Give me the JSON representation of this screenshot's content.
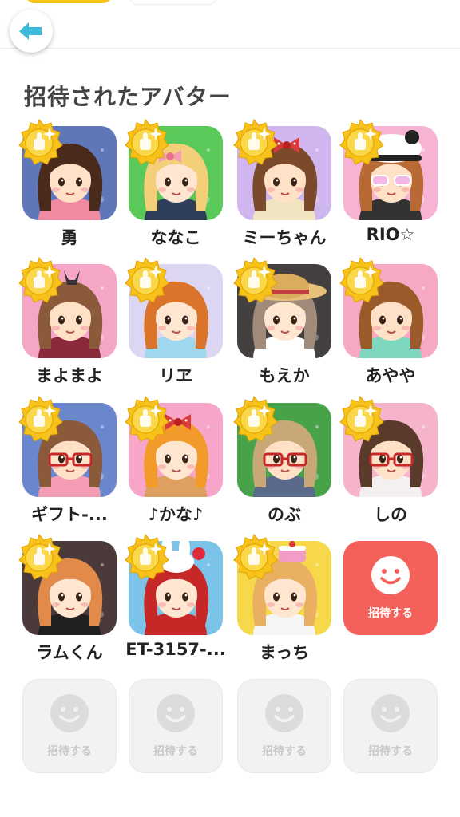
{
  "header": {
    "back_icon": "back-arrow-icon"
  },
  "section_title": "招待されたアバター",
  "avatars": [
    {
      "name": "勇",
      "bg": "#5f77b8",
      "hair": "#4a2a1a",
      "skin": "#ffe1c8",
      "top": "#f08aa0",
      "acc": "none"
    },
    {
      "name": "ななこ",
      "bg": "#5ac95a",
      "hair": "#f3cf7a",
      "skin": "#ffe6d0",
      "top": "#2f3e5a",
      "acc": "bow"
    },
    {
      "name": "ミーちゃん",
      "bg": "#cfb6ee",
      "hair": "#7a4a2a",
      "skin": "#ffe1c8",
      "top": "#f0e4c0",
      "acc": "redbow"
    },
    {
      "name": "RIO☆",
      "bg": "#f6b3d4",
      "hair": "#b86a34",
      "skin": "#ffe1c8",
      "top": "#333333",
      "acc": "panda"
    },
    {
      "name": "まよまよ",
      "bg": "#f5a6c6",
      "hair": "#8a5a3a",
      "skin": "#ffe1c8",
      "top": "#8a2a3a",
      "acc": "cat"
    },
    {
      "name": "リヱ",
      "bg": "#ddd6f2",
      "hair": "#d9742a",
      "skin": "#ffe6d0",
      "top": "#9ed7ee",
      "acc": "none"
    },
    {
      "name": "もえか",
      "bg": "#444040",
      "hair": "#a08a7a",
      "skin": "#ffe6d0",
      "top": "#ffffff",
      "acc": "hat"
    },
    {
      "name": "あやや",
      "bg": "#f7a8c2",
      "hair": "#9a5a2a",
      "skin": "#ffe1c8",
      "top": "#7ed8c0",
      "acc": "none"
    },
    {
      "name": "ギフト-...",
      "bg": "#6a86cc",
      "hair": "#8a5a3a",
      "skin": "#ffe1c8",
      "top": "#f39cb4",
      "acc": "glasses"
    },
    {
      "name": "♪かな♪",
      "bg": "#f7a5c8",
      "hair": "#f29a2a",
      "skin": "#ffe6d0",
      "top": "#e0a060",
      "acc": "redbow"
    },
    {
      "name": "のぶ",
      "bg": "#47a24a",
      "hair": "#c9a878",
      "skin": "#ffe1c8",
      "top": "#5a6a8a",
      "acc": "glasses"
    },
    {
      "name": "しの",
      "bg": "#f5b4cc",
      "hair": "#5a3a2a",
      "skin": "#ffe1c8",
      "top": "#f5f0f0",
      "acc": "glasses"
    },
    {
      "name": "ラムくん",
      "bg": "#4a3a3a",
      "hair": "#e28a4a",
      "skin": "#ffe6d0",
      "top": "#202020",
      "acc": "none"
    },
    {
      "name": "ET-3157-...",
      "bg": "#7cc3ea",
      "hair": "#c62828",
      "skin": "#ffe6d0",
      "top": "#c62828",
      "acc": "bunny"
    },
    {
      "name": "まっち",
      "bg": "#f7d84a",
      "hair": "#e8b060",
      "skin": "#ffe6d0",
      "top": "#f5f5f5",
      "acc": "cake"
    }
  ],
  "invite_active": {
    "label": "招待する"
  },
  "invite_placeholders": [
    {
      "label": "招待する"
    },
    {
      "label": "招待する"
    },
    {
      "label": "招待する"
    },
    {
      "label": "招待する"
    }
  ],
  "colors": {
    "accent_red": "#f4605a",
    "medal_gold": "#f7c21b",
    "back_arrow": "#3cb8d8"
  }
}
